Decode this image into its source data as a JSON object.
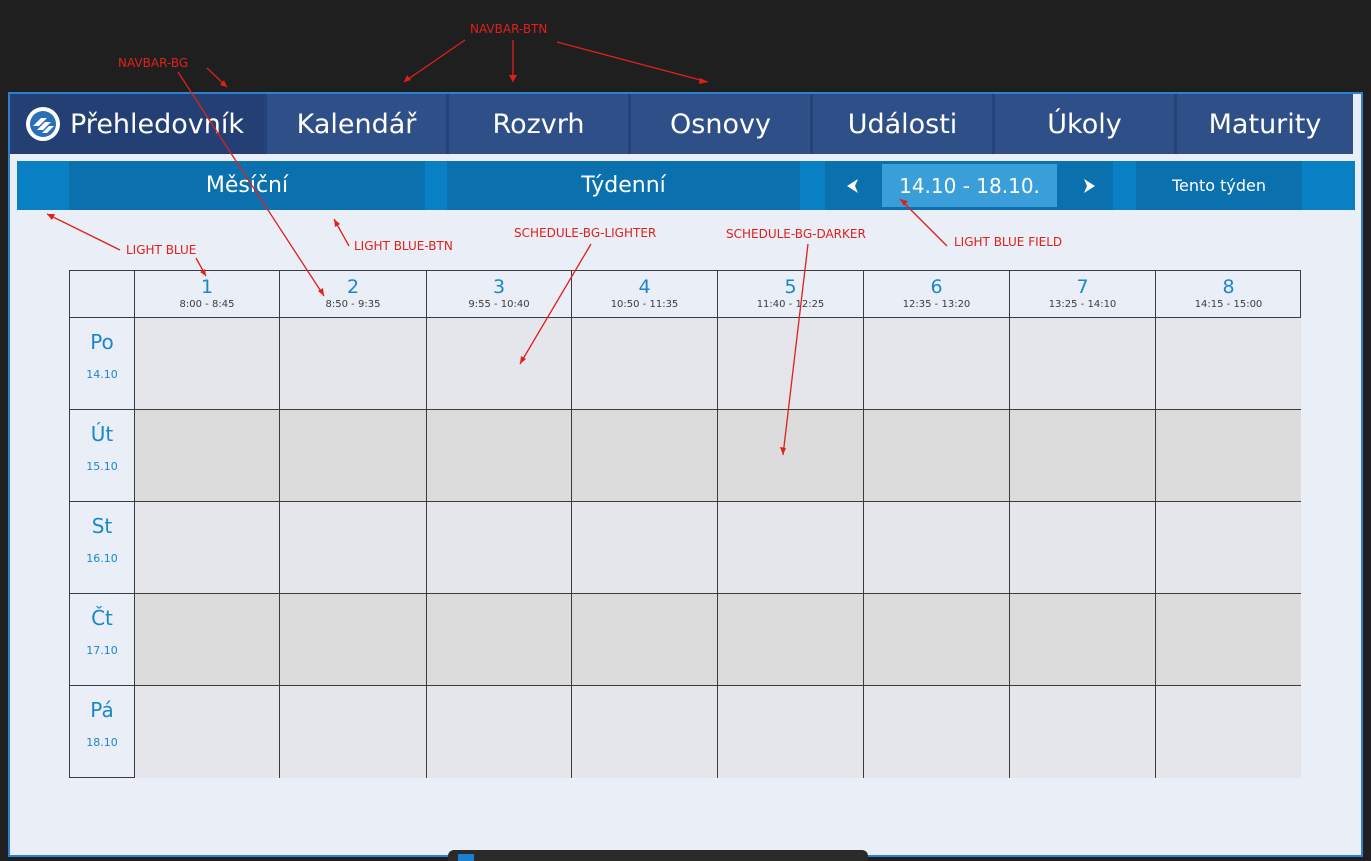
{
  "navbar": {
    "brand": "Přehledovník",
    "items": [
      "Kalendář",
      "Rozvrh",
      "Osnovy",
      "Události",
      "Úkoly",
      "Maturity"
    ]
  },
  "subbar": {
    "monthly": "Měsíční",
    "weekly": "Týdenní",
    "week_range": "14.10 - 18.10.",
    "this_week": "Tento týden"
  },
  "schedule": {
    "periods": [
      {
        "num": "1",
        "time": "8:00 - 8:45"
      },
      {
        "num": "2",
        "time": "8:50 - 9:35"
      },
      {
        "num": "3",
        "time": "9:55 - 10:40"
      },
      {
        "num": "4",
        "time": "10:50 - 11:35"
      },
      {
        "num": "5",
        "time": "11:40 - 12:25"
      },
      {
        "num": "6",
        "time": "12:35 - 13:20"
      },
      {
        "num": "7",
        "time": "13:25 - 14:10"
      },
      {
        "num": "8",
        "time": "14:15 - 15:00"
      }
    ],
    "days": [
      {
        "name": "Po",
        "date": "14.10"
      },
      {
        "name": "Út",
        "date": "15.10"
      },
      {
        "name": "St",
        "date": "16.10"
      },
      {
        "name": "Čt",
        "date": "17.10"
      },
      {
        "name": "Pá",
        "date": "18.10"
      }
    ]
  },
  "annotations": {
    "navbar_btn": "NAVBAR-BTN",
    "navbar_bg": "NAVBAR-BG",
    "light_blue": "LIGHT BLUE",
    "light_blue_btn": "LIGHT BLUE-BTN",
    "schedule_bg_lighter": "SCHEDULE-BG-LIGHTER",
    "schedule_bg_darker": "SCHEDULE-BG-DARKER",
    "light_blue_field": "LIGHT BLUE FIELD"
  },
  "colors": {
    "navbar_bg": "#243f73",
    "navbar_btn": "#2f4f88",
    "light_blue": "#0a80c4",
    "light_blue_btn": "#0b71ae",
    "light_blue_field": "#3a9fd8",
    "schedule_bg_lighter": "#e4e6ec",
    "schedule_bg_darker": "#dcdcdc",
    "annotation": "#e0201a"
  }
}
